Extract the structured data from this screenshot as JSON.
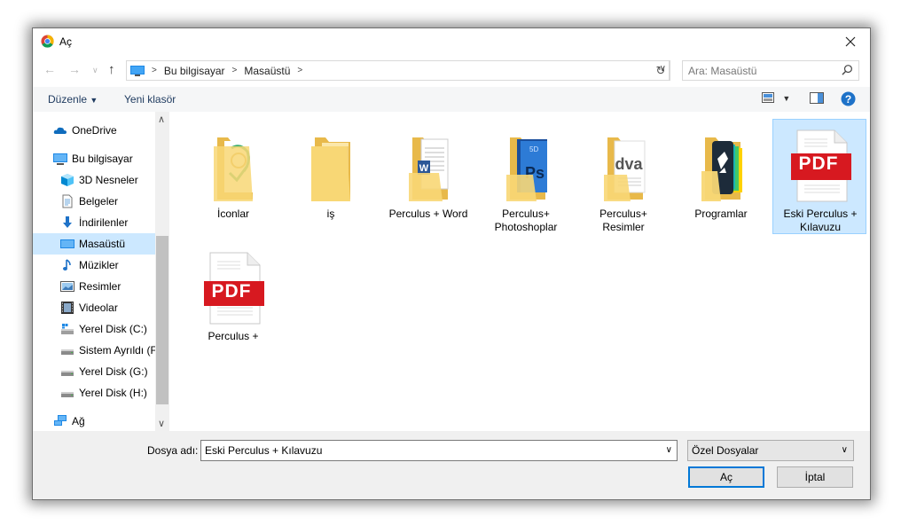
{
  "window": {
    "title": "Aç"
  },
  "nav": {
    "breadcrumb": [
      "Bu bilgisayar",
      "Masaüstü"
    ],
    "search_placeholder": "Ara: Masaüstü"
  },
  "toolbar": {
    "organize": "Düzenle",
    "new_folder": "Yeni klasör"
  },
  "sidebar": {
    "items": [
      {
        "label": "OneDrive",
        "icon": "onedrive-icon"
      },
      {
        "label": "Bu bilgisayar",
        "icon": "computer-icon"
      },
      {
        "label": "3D Nesneler",
        "icon": "3d-objects-icon"
      },
      {
        "label": "Belgeler",
        "icon": "documents-icon"
      },
      {
        "label": "İndirilenler",
        "icon": "downloads-icon"
      },
      {
        "label": "Masaüstü",
        "icon": "desktop-icon",
        "selected": true
      },
      {
        "label": "Müzikler",
        "icon": "music-icon"
      },
      {
        "label": "Resimler",
        "icon": "pictures-icon"
      },
      {
        "label": "Videolar",
        "icon": "videos-icon"
      },
      {
        "label": "Yerel Disk (C:)",
        "icon": "drive-icon"
      },
      {
        "label": "Sistem Ayrıldı (F:)",
        "icon": "drive-icon"
      },
      {
        "label": "Yerel Disk (G:)",
        "icon": "drive-icon"
      },
      {
        "label": "Yerel Disk (H:)",
        "icon": "drive-icon"
      },
      {
        "label": "Ağ",
        "icon": "network-icon"
      }
    ]
  },
  "files": [
    {
      "name": "İconlar",
      "type": "folder",
      "preview": "icons"
    },
    {
      "name": "iş",
      "type": "folder",
      "preview": "plain"
    },
    {
      "name": "Perculus + Word",
      "type": "folder",
      "preview": "word"
    },
    {
      "name": "Perculus+ Photoshoplar",
      "type": "folder",
      "preview": "photoshop"
    },
    {
      "name": "Perculus+ Resimler",
      "type": "folder",
      "preview": "images"
    },
    {
      "name": "Programlar",
      "type": "folder",
      "preview": "programs"
    },
    {
      "name": "Eski Perculus + Kılavuzu",
      "type": "pdf",
      "selected": true,
      "badge": "PDF"
    },
    {
      "name": "Perculus +",
      "type": "pdf",
      "badge": "PDF"
    }
  ],
  "footer": {
    "filename_label": "Dosya adı:",
    "filename_value": "Eski Perculus + Kılavuzu",
    "filetype_value": "Özel Dosyalar",
    "open_button": "Aç",
    "cancel_button": "İptal"
  },
  "colors": {
    "accent": "#0078d7",
    "selection": "#cce8ff",
    "pdf_red": "#d71920",
    "folder": "#f8d775"
  }
}
